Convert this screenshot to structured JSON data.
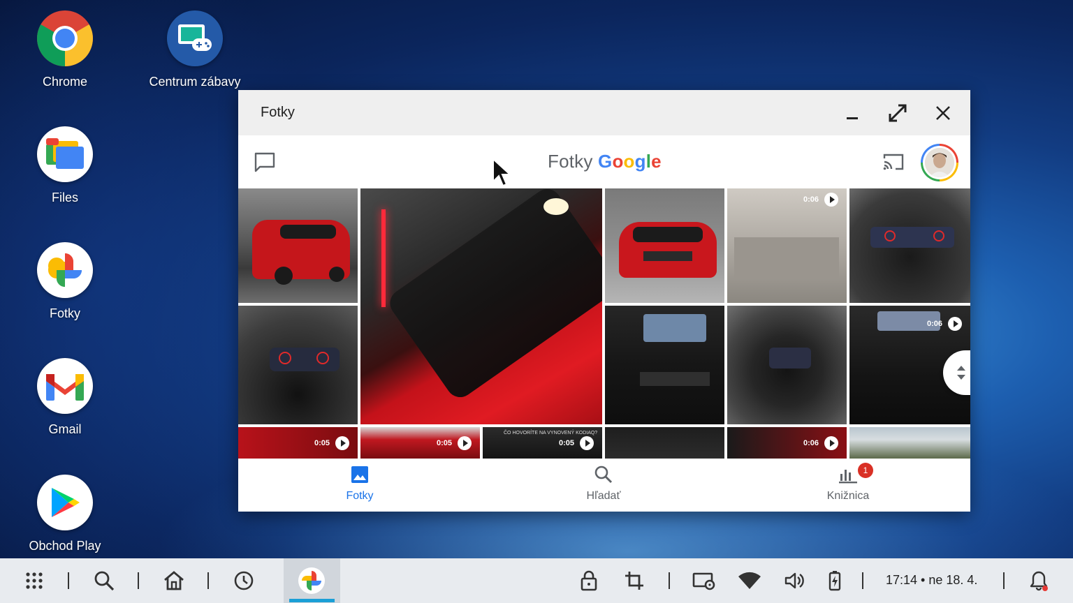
{
  "desktop": {
    "icons": [
      {
        "label": "Chrome"
      },
      {
        "label": "Centrum zábavy"
      },
      {
        "label": "Files"
      },
      {
        "label": "Fotky"
      },
      {
        "label": "Gmail"
      },
      {
        "label": "Obchod Play"
      }
    ]
  },
  "window": {
    "title": "Fotky",
    "logo_word": "Fotky",
    "logo_brand": [
      "G",
      "o",
      "o",
      "g",
      "l",
      "e"
    ],
    "brand_colors": [
      "#4285f4",
      "#ea4335",
      "#fbbc04",
      "#4285f4",
      "#34a853",
      "#ea4335"
    ]
  },
  "grid": {
    "durations": [
      "0:06",
      "0:06",
      "0:05",
      "0:05",
      "0:05",
      "0:06"
    ],
    "captions": [
      "ČO HOVORÍTE NA VYNOVENÝ KODIAQ?"
    ]
  },
  "bottom_nav": {
    "items": [
      {
        "label": "Fotky",
        "icon": "photo-icon",
        "active": true
      },
      {
        "label": "Hľadať",
        "icon": "search-icon",
        "active": false
      },
      {
        "label": "Knižnica",
        "icon": "library-icon",
        "active": false
      }
    ],
    "badge": "1",
    "active_color": "#1a73e8"
  },
  "taskbar": {
    "clock": "17:14 • ne 18. 4."
  }
}
